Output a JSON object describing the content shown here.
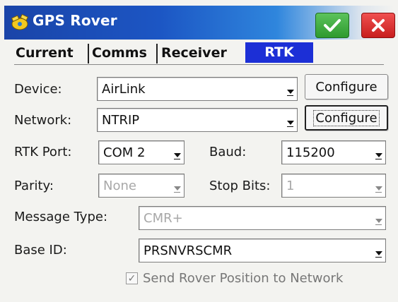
{
  "window": {
    "title": "GPS Rover",
    "ok_icon": "checkmark-icon",
    "close_icon": "close-icon",
    "accent": "#1c2fd6"
  },
  "tabs": [
    {
      "label": "Current",
      "active": false
    },
    {
      "label": "Comms",
      "active": false
    },
    {
      "label": "Receiver",
      "active": false
    },
    {
      "label": "RTK",
      "active": true
    }
  ],
  "form": {
    "device": {
      "label": "Device:",
      "value": "AirLink",
      "button": "Configure"
    },
    "network": {
      "label": "Network:",
      "value": "NTRIP",
      "button": "Configure"
    },
    "rtk_port": {
      "label": "RTK Port:",
      "value": "COM 2"
    },
    "baud": {
      "label": "Baud:",
      "value": "115200"
    },
    "parity": {
      "label": "Parity:",
      "value": "None"
    },
    "stop_bits": {
      "label": "Stop Bits:",
      "value": "1"
    },
    "message_type": {
      "label": "Message Type:",
      "value": "CMR+"
    },
    "base_id": {
      "label": "Base ID:",
      "value": "PRSNVRSCMR"
    },
    "send_position": {
      "label": "Send Rover Position to Network",
      "checked": true
    }
  }
}
